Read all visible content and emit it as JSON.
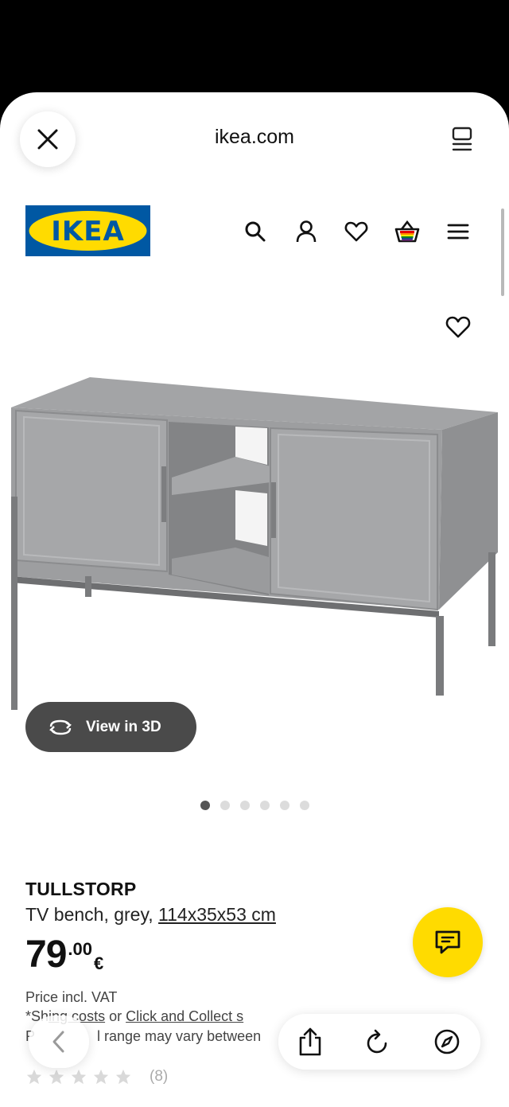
{
  "browser": {
    "url": "ikea.com"
  },
  "site": {
    "logo_text": "IKEA"
  },
  "product": {
    "view_3d_label": "View in 3D",
    "carousel": {
      "count": 6,
      "active_index": 0
    },
    "name": "TULLSTORP",
    "description_prefix": "TV bench, grey, ",
    "dimensions": "114x35x53 cm",
    "price_integer": "79",
    "price_decimal": ".00",
    "currency": "€",
    "price_note": "Price incl. VAT",
    "shipping_prefix": "*Sh",
    "shipping_link": "ing costs",
    "shipping_or": " or ",
    "click_collect_link": "Click and Collect s",
    "range_prefix": "P",
    "range_text": "l range may vary between",
    "rating_count": "(8)",
    "rating_stars": 5
  },
  "colors": {
    "ikea_blue": "#0058a3",
    "ikea_yellow": "#ffdb00",
    "view3d_bg": "#4a4a4a"
  },
  "icons": {
    "close": "close-icon",
    "tabs": "tabs-icon",
    "search": "search-icon",
    "account": "person-icon",
    "wishlist": "heart-icon",
    "basket": "basket-icon",
    "menu": "hamburger-menu-icon",
    "chat": "chat-icon",
    "back": "chevron-left-icon",
    "share": "share-icon",
    "reload": "reload-icon",
    "compass": "compass-icon"
  }
}
